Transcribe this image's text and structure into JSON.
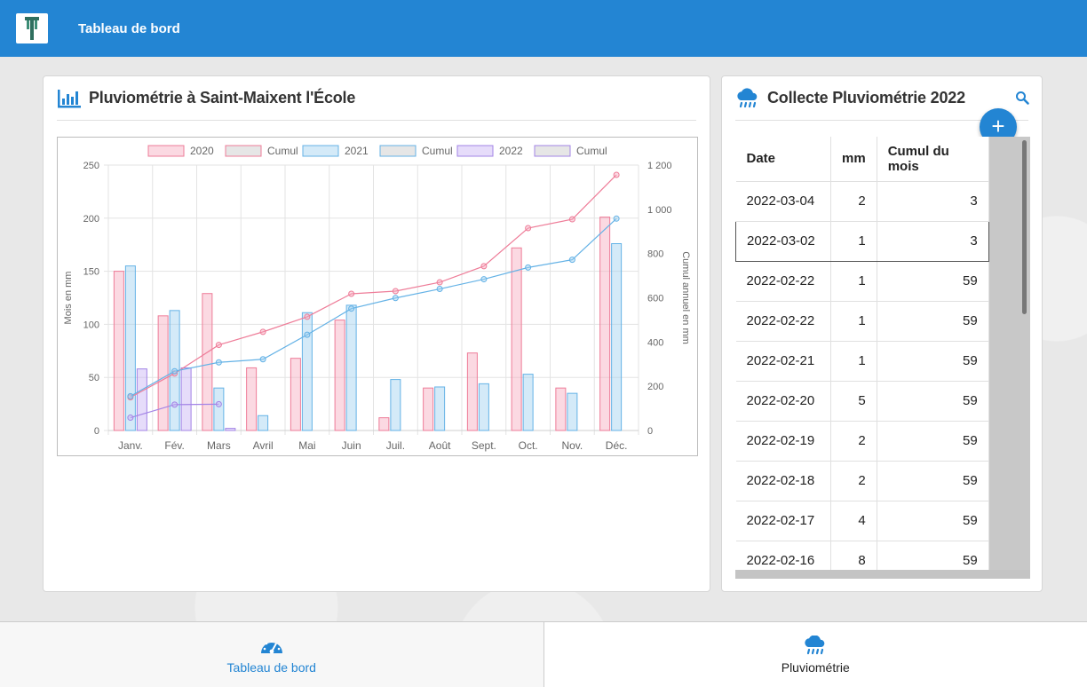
{
  "header": {
    "title": "Tableau de bord"
  },
  "rain_chart_card": {
    "title": "Pluviométrie à Saint-Maixent l'École"
  },
  "collect_card": {
    "title": "Collecte Pluviométrie 2022",
    "add_label": "+",
    "table": {
      "columns": [
        "Date",
        "mm",
        "Cumul du mois"
      ],
      "rows": [
        {
          "date": "2022-03-04",
          "mm": "2",
          "cumul": "3"
        },
        {
          "date": "2022-03-02",
          "mm": "1",
          "cumul": "3"
        },
        {
          "date": "2022-02-22",
          "mm": "1",
          "cumul": "59"
        },
        {
          "date": "2022-02-22",
          "mm": "1",
          "cumul": "59"
        },
        {
          "date": "2022-02-21",
          "mm": "1",
          "cumul": "59"
        },
        {
          "date": "2022-02-20",
          "mm": "5",
          "cumul": "59"
        },
        {
          "date": "2022-02-19",
          "mm": "2",
          "cumul": "59"
        },
        {
          "date": "2022-02-18",
          "mm": "2",
          "cumul": "59"
        },
        {
          "date": "2022-02-17",
          "mm": "4",
          "cumul": "59"
        },
        {
          "date": "2022-02-16",
          "mm": "8",
          "cumul": "59"
        }
      ]
    }
  },
  "bottom_nav": {
    "items": [
      {
        "label": "Tableau de bord"
      },
      {
        "label": "Pluviométrie"
      }
    ]
  },
  "colors": {
    "primary": "#2385d3",
    "pink": "#f27a96",
    "blue": "#5aaee6",
    "purple": "#9a7ee0"
  },
  "chart_data": {
    "type": "bar",
    "categories": [
      "Janv.",
      "Fév.",
      "Mars",
      "Avril",
      "Mai",
      "Juin",
      "Juil.",
      "Août",
      "Sept.",
      "Oct.",
      "Nov.",
      "Déc."
    ],
    "ylabel": "Mois en mm",
    "y2label": "Cumul annuel en mm",
    "ylim": [
      0,
      250
    ],
    "y2lim": [
      0,
      1200
    ],
    "yticks": [
      "0",
      "50",
      "100",
      "150",
      "200",
      "250"
    ],
    "y2ticks": [
      "0",
      "200",
      "400",
      "600",
      "800",
      "1 000",
      "1 200"
    ],
    "legend": [
      "2020",
      "Cumul",
      "2021",
      "Cumul",
      "2022",
      "Cumul"
    ],
    "legend_position": "top",
    "series": [
      {
        "name": "2020",
        "kind": "bar",
        "axis": "left",
        "color": "pink",
        "values": [
          150,
          108,
          129,
          59,
          68,
          104,
          12,
          40,
          73,
          172,
          40,
          201
        ]
      },
      {
        "name": "2021",
        "kind": "bar",
        "axis": "left",
        "color": "blue",
        "values": [
          155,
          113,
          40,
          14,
          111,
          118,
          48,
          41,
          44,
          53,
          35,
          176
        ]
      },
      {
        "name": "2022",
        "kind": "bar",
        "axis": "left",
        "color": "purple",
        "values": [
          58,
          59,
          2
        ]
      },
      {
        "name": "Cumul",
        "kind": "line",
        "axis": "right",
        "color": "pink",
        "values": [
          150,
          258,
          387,
          446,
          514,
          618,
          630,
          670,
          743,
          915,
          955,
          1156
        ]
      },
      {
        "name": "Cumul",
        "kind": "line",
        "axis": "right",
        "color": "blue",
        "values": [
          155,
          268,
          308,
          322,
          433,
          551,
          599,
          640,
          684,
          737,
          772,
          958
        ]
      },
      {
        "name": "Cumul",
        "kind": "line",
        "axis": "right",
        "color": "purple",
        "values": [
          58,
          117,
          119
        ]
      }
    ]
  }
}
